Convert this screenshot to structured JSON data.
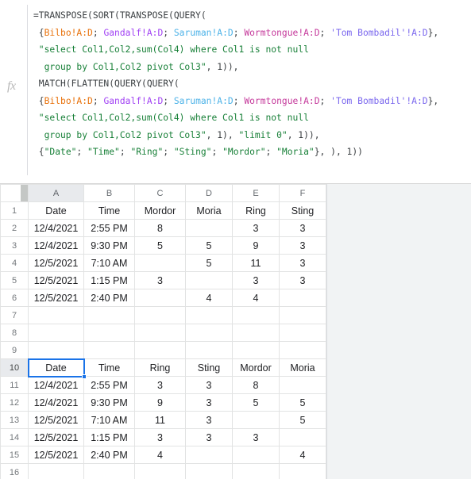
{
  "formula_bar": {
    "fx_icon": "fx",
    "lines": [
      [
        {
          "t": "=TRANSPOSE(SORT(TRANSPOSE(QUERY(",
          "c": "tok-plain"
        }
      ],
      [
        {
          "t": " {",
          "c": "tok-plain"
        },
        {
          "t": "Bilbo!A:D",
          "c": "ref-1"
        },
        {
          "t": "; ",
          "c": "tok-plain"
        },
        {
          "t": "Gandalf!A:D",
          "c": "ref-2"
        },
        {
          "t": "; ",
          "c": "tok-plain"
        },
        {
          "t": "Saruman!A:D",
          "c": "ref-3"
        },
        {
          "t": "; ",
          "c": "tok-plain"
        },
        {
          "t": "Wormtongue!A:D",
          "c": "ref-4"
        },
        {
          "t": "; ",
          "c": "tok-plain"
        },
        {
          "t": "'Tom Bombadil'!A:D",
          "c": "ref-5"
        },
        {
          "t": "},",
          "c": "tok-plain"
        }
      ],
      [
        {
          "t": " \"select Col1,Col2,sum(Col4) where Col1 is not null",
          "c": "tok-str"
        }
      ],
      [
        {
          "t": "  group by Col1,Col2 pivot Col3\"",
          "c": "tok-str"
        },
        {
          "t": ", 1)),",
          "c": "tok-num"
        }
      ],
      [
        {
          "t": " MATCH(FLATTEN(QUERY(QUERY(",
          "c": "tok-plain"
        }
      ],
      [
        {
          "t": " {",
          "c": "tok-plain"
        },
        {
          "t": "Bilbo!A:D",
          "c": "ref-1"
        },
        {
          "t": "; ",
          "c": "tok-plain"
        },
        {
          "t": "Gandalf!A:D",
          "c": "ref-2"
        },
        {
          "t": "; ",
          "c": "tok-plain"
        },
        {
          "t": "Saruman!A:D",
          "c": "ref-3"
        },
        {
          "t": "; ",
          "c": "tok-plain"
        },
        {
          "t": "Wormtongue!A:D",
          "c": "ref-4"
        },
        {
          "t": "; ",
          "c": "tok-plain"
        },
        {
          "t": "'Tom Bombadil'!A:D",
          "c": "ref-5"
        },
        {
          "t": "},",
          "c": "tok-plain"
        }
      ],
      [
        {
          "t": " \"select Col1,Col2,sum(Col4) where Col1 is not null",
          "c": "tok-str"
        }
      ],
      [
        {
          "t": "  group by Col1,Col2 pivot Col3\"",
          "c": "tok-str"
        },
        {
          "t": ", 1), ",
          "c": "tok-num"
        },
        {
          "t": "\"limit 0\"",
          "c": "tok-str"
        },
        {
          "t": ", 1)),",
          "c": "tok-num"
        }
      ],
      [
        {
          "t": " {",
          "c": "tok-plain"
        },
        {
          "t": "\"Date\"",
          "c": "tok-str"
        },
        {
          "t": "; ",
          "c": "tok-plain"
        },
        {
          "t": "\"Time\"",
          "c": "tok-str"
        },
        {
          "t": "; ",
          "c": "tok-plain"
        },
        {
          "t": "\"Ring\"",
          "c": "tok-str"
        },
        {
          "t": "; ",
          "c": "tok-plain"
        },
        {
          "t": "\"Sting\"",
          "c": "tok-str"
        },
        {
          "t": "; ",
          "c": "tok-plain"
        },
        {
          "t": "\"Mordor\"",
          "c": "tok-str"
        },
        {
          "t": "; ",
          "c": "tok-plain"
        },
        {
          "t": "\"Moria\"",
          "c": "tok-str"
        },
        {
          "t": "}, ), 1))",
          "c": "tok-plain"
        }
      ]
    ]
  },
  "sheet": {
    "column_headers": [
      "A",
      "B",
      "C",
      "D",
      "E",
      "F"
    ],
    "selected_column": "A",
    "selected_row": 10,
    "selected_cell": "A10",
    "row_numbers": [
      1,
      2,
      3,
      4,
      5,
      6,
      7,
      8,
      9,
      10,
      11,
      12,
      13,
      14,
      15,
      16
    ],
    "rows": [
      {
        "n": 1,
        "cells": [
          "Date",
          "Time",
          "Mordor",
          "Moria",
          "Ring",
          "Sting"
        ]
      },
      {
        "n": 2,
        "cells": [
          "12/4/2021",
          "2:55 PM",
          "8",
          "",
          "3",
          "3"
        ]
      },
      {
        "n": 3,
        "cells": [
          "12/4/2021",
          "9:30 PM",
          "5",
          "5",
          "9",
          "3"
        ]
      },
      {
        "n": 4,
        "cells": [
          "12/5/2021",
          "7:10 AM",
          "",
          "5",
          "11",
          "3"
        ]
      },
      {
        "n": 5,
        "cells": [
          "12/5/2021",
          "1:15 PM",
          "3",
          "",
          "3",
          "3"
        ]
      },
      {
        "n": 6,
        "cells": [
          "12/5/2021",
          "2:40 PM",
          "",
          "4",
          "4",
          ""
        ]
      },
      {
        "n": 7,
        "cells": [
          "",
          "",
          "",
          "",
          "",
          ""
        ]
      },
      {
        "n": 8,
        "cells": [
          "",
          "",
          "",
          "",
          "",
          ""
        ]
      },
      {
        "n": 9,
        "cells": [
          "",
          "",
          "",
          "",
          "",
          ""
        ]
      },
      {
        "n": 10,
        "cells": [
          "Date",
          "Time",
          "Ring",
          "Sting",
          "Mordor",
          "Moria"
        ]
      },
      {
        "n": 11,
        "cells": [
          "12/4/2021",
          "2:55 PM",
          "3",
          "3",
          "8",
          ""
        ]
      },
      {
        "n": 12,
        "cells": [
          "12/4/2021",
          "9:30 PM",
          "9",
          "3",
          "5",
          "5"
        ]
      },
      {
        "n": 13,
        "cells": [
          "12/5/2021",
          "7:10 AM",
          "11",
          "3",
          "",
          "5"
        ]
      },
      {
        "n": 14,
        "cells": [
          "12/5/2021",
          "1:15 PM",
          "3",
          "3",
          "3",
          ""
        ]
      },
      {
        "n": 15,
        "cells": [
          "12/5/2021",
          "2:40 PM",
          "4",
          "",
          "",
          "4"
        ]
      },
      {
        "n": 16,
        "cells": [
          "",
          "",
          "",
          "",
          "",
          ""
        ]
      }
    ]
  },
  "colors": {
    "selection": "#1a73e8",
    "header_selected_bg": "#e8eaed",
    "grid_line": "#e2e3e3",
    "outside_grid_bg": "#f1f3f4",
    "string_token": "#188038",
    "ref_bilbo": "#e8710a",
    "ref_gandalf": "#a142f4",
    "ref_saruman": "#4eb3e8",
    "ref_wormtongue": "#c5399b",
    "ref_tom_bombadil": "#7b68ee"
  }
}
